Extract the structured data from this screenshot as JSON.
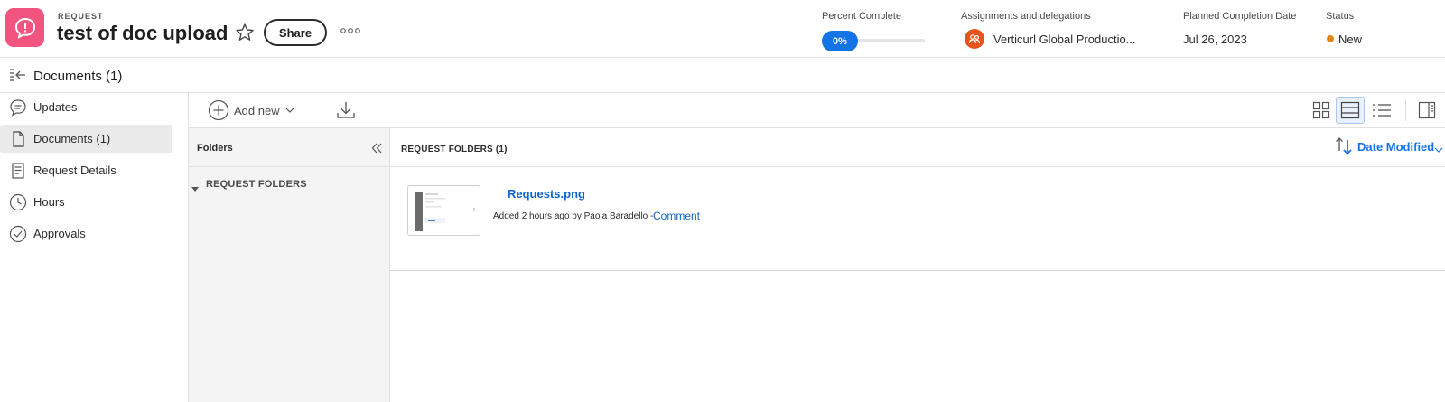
{
  "header": {
    "type_label": "REQUEST",
    "title": "test of doc upload",
    "share_label": "Share",
    "percent_complete_label": "Percent Complete",
    "percent_complete_value": "0%",
    "percent_complete_fraction": 0,
    "assignments_label": "Assignments and delegations",
    "assignments_value": "Verticurl Global Productio...",
    "planned_completion_label": "Planned Completion Date",
    "planned_completion_value": "Jul 26, 2023",
    "status_label": "Status",
    "status_value": "New",
    "status_color": "#e68619",
    "brand_color": "#f0547f"
  },
  "subheader": {
    "title": "Documents (1)"
  },
  "nav": {
    "items": [
      {
        "label": "Updates",
        "icon": "speech-bubble-icon"
      },
      {
        "label": "Documents (1)",
        "icon": "document-icon",
        "active": true
      },
      {
        "label": "Request Details",
        "icon": "details-icon"
      },
      {
        "label": "Hours",
        "icon": "clock-icon"
      },
      {
        "label": "Approvals",
        "icon": "checkmark-circle-icon"
      }
    ]
  },
  "toolbar": {
    "add_new_label": "Add new"
  },
  "folders": {
    "title": "Folders",
    "tree_root": "REQUEST FOLDERS"
  },
  "content": {
    "title": "REQUEST FOLDERS (1)",
    "sort_label": "Date Modified",
    "documents": [
      {
        "name": "Requests.png",
        "meta": "Added 2 hours ago by Paola Baradello -",
        "comment_label": "Comment"
      }
    ]
  },
  "accent_color": "#1473e6"
}
